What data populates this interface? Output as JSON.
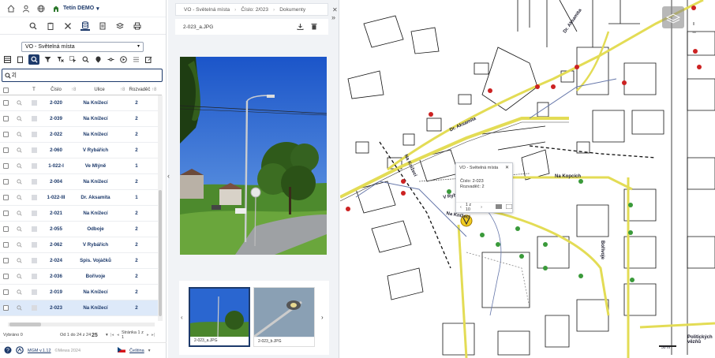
{
  "left_panel": {
    "project_label": "Tetín DEMO",
    "layer_select": "VO - Světelná místa",
    "search_value": "2",
    "table": {
      "headers": [
        "Číslo",
        "Ulice",
        "Rozvaděč"
      ],
      "rows": [
        {
          "cislo": "2-020",
          "ulice": "Na Knížecí",
          "rozvadec": "2"
        },
        {
          "cislo": "2-039",
          "ulice": "Na Knížecí",
          "rozvadec": "2"
        },
        {
          "cislo": "2-022",
          "ulice": "Na Knížecí",
          "rozvadec": "2"
        },
        {
          "cislo": "2-060",
          "ulice": "V Rybářích",
          "rozvadec": "2"
        },
        {
          "cislo": "1-022-I",
          "ulice": "Ve Mlýně",
          "rozvadec": "1"
        },
        {
          "cislo": "2-004",
          "ulice": "Na Knížecí",
          "rozvadec": "2"
        },
        {
          "cislo": "1-022-III",
          "ulice": "Dr. Aksamita",
          "rozvadec": "1"
        },
        {
          "cislo": "2-021",
          "ulice": "Na Knížecí",
          "rozvadec": "2"
        },
        {
          "cislo": "2-055",
          "ulice": "Odboje",
          "rozvadec": "2"
        },
        {
          "cislo": "2-062",
          "ulice": "V Rybářích",
          "rozvadec": "2"
        },
        {
          "cislo": "2-024",
          "ulice": "Spis. Vojáčků",
          "rozvadec": "2"
        },
        {
          "cislo": "2-036",
          "ulice": "Bořivoje",
          "rozvadec": "2"
        },
        {
          "cislo": "2-019",
          "ulice": "Na Knížecí",
          "rozvadec": "2"
        },
        {
          "cislo": "2-023",
          "ulice": "Na Knížecí",
          "rozvadec": "2"
        }
      ]
    },
    "footer": {
      "selected": "Vybráno 0",
      "range": "Od 1 do 24 z 24",
      "page_size": "25",
      "page_info": "Stránka 1 z 1"
    },
    "bottom": {
      "version": "MGM v.1.12",
      "copyright": "©Mewa 2024",
      "language": "Čeština"
    }
  },
  "documents": {
    "breadcrumb": [
      "VO - Světelná místa",
      "Číslo: 2/023",
      "Dokumenty"
    ],
    "filename": "2-023_a.JPG",
    "thumbs": [
      "2-023_a.JPG",
      "2-023_b.JPG"
    ]
  },
  "map": {
    "popup": {
      "title": "VO - Světelná místa",
      "cislo": "Číslo: 2-023",
      "rozvadec": "Rozvaděč: 2",
      "pager": "1 z 10"
    },
    "streets": [
      "Dr. Aksamita",
      "Dr. Aksamita",
      "Na Kopcích",
      "Na Knížecí",
      "Na Knížecí",
      "V Rybářích",
      "Politických vězňů",
      "Bořivoje"
    ],
    "scale": "50 m"
  },
  "colors": {
    "accent": "#1d3a6b",
    "road": "#e3dc55"
  }
}
